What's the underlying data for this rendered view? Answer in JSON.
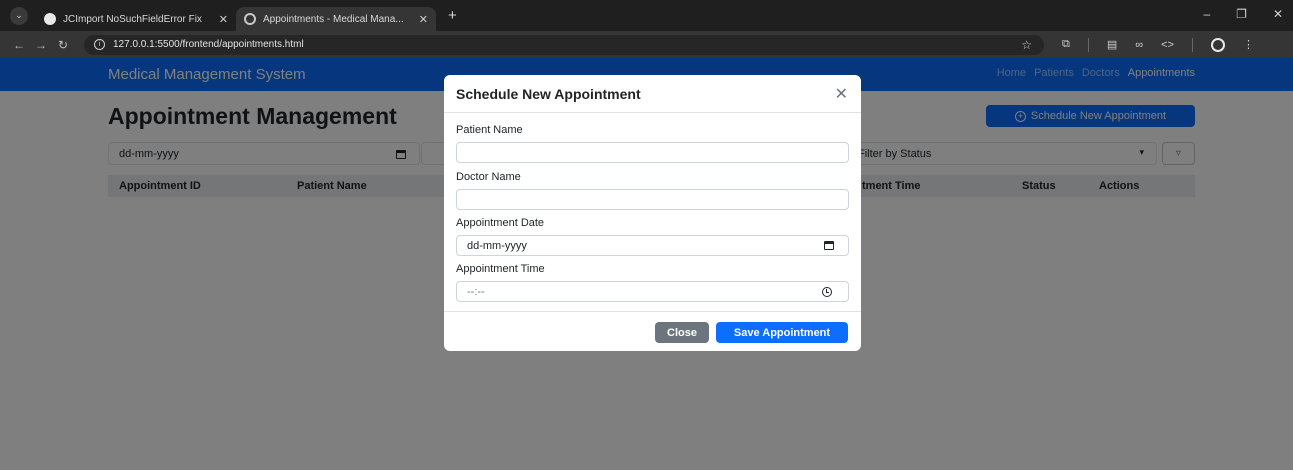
{
  "browser": {
    "tabs": [
      {
        "title": "JCImport NoSuchFieldError Fix"
      },
      {
        "title": "Appointments - Medical Mana..."
      }
    ],
    "url": "127.0.0.1:5500/frontend/appointments.html",
    "icons": [
      "tab-list-icon",
      "back-icon",
      "forward-icon",
      "reload-icon",
      "star-icon",
      "extensions-icon",
      "profile-icon",
      "menu-icon"
    ]
  },
  "navbar": {
    "brand": "Medical Management System",
    "links": [
      "Home",
      "Patients",
      "Doctors",
      "Appointments"
    ],
    "active_link": "Appointments"
  },
  "main": {
    "heading": "Appointment Management",
    "schedule_button": "Schedule New Appointment",
    "filters": {
      "date_value": "dd-mm-yyyy",
      "status_placeholder": "Filter by Status"
    },
    "table_headers": [
      "Appointment ID",
      "Patient Name",
      "tment Time",
      "Status",
      "Actions"
    ]
  },
  "modal": {
    "title": "Schedule New Appointment",
    "fields": [
      {
        "label": "Patient Name",
        "value": ""
      },
      {
        "label": "Doctor Name",
        "value": ""
      },
      {
        "label": "Appointment Date",
        "value": "dd-mm-yyyy"
      },
      {
        "label": "Appointment Time",
        "value": "--:--"
      }
    ],
    "close_button": "Close",
    "save_button": "Save Appointment"
  },
  "colors": {
    "primary": "#0d6efd",
    "secondary": "#6c757d",
    "backdrop": "rgba(0,0,0,0.5)"
  }
}
